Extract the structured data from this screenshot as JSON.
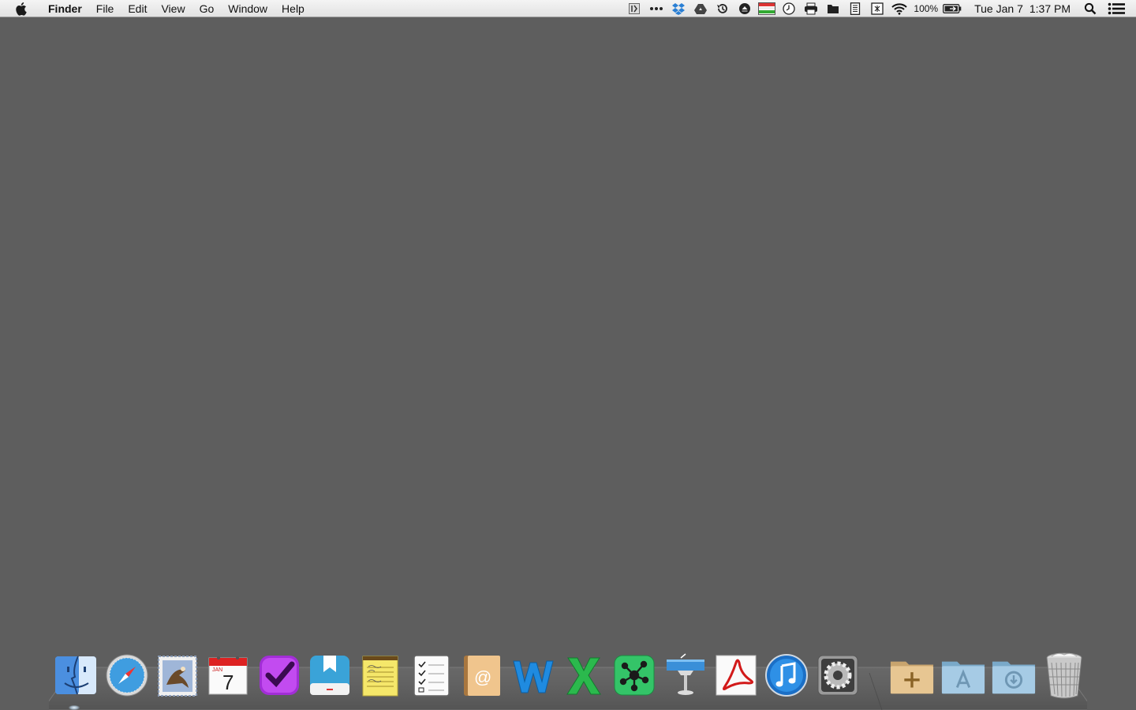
{
  "menubar": {
    "apple_icon": "apple-logo-icon",
    "items": [
      "Finder",
      "File",
      "Edit",
      "View",
      "Go",
      "Window",
      "Help"
    ],
    "status_icons": [
      "bracket-extension-icon",
      "more-dots-icon",
      "dropbox-icon",
      "google-drive-icon",
      "time-machine-icon",
      "eject-icon",
      "flag-strip-icon",
      "clock-icon",
      "printer-icon",
      "folder-icon",
      "document-icon",
      "screen-icon",
      "wifi-icon"
    ],
    "battery_percent": "100%",
    "battery_icon": "battery-charging-icon",
    "day": "Tue Jan 7",
    "time": "1:37 PM",
    "right_icons": [
      "spotlight-search-icon",
      "notification-center-icon"
    ]
  },
  "desktop": {
    "background": "#5e5e5e"
  },
  "dock": {
    "apps": [
      {
        "name": "finder-icon",
        "running": true
      },
      {
        "name": "safari-icon"
      },
      {
        "name": "mail-icon"
      },
      {
        "name": "calendar-icon",
        "month": "JAN",
        "day": "7"
      },
      {
        "name": "omnifocus-icon"
      },
      {
        "name": "day-one-icon"
      },
      {
        "name": "notes-icon"
      },
      {
        "name": "reminders-icon"
      },
      {
        "name": "contacts-icon"
      },
      {
        "name": "word-icon"
      },
      {
        "name": "excel-icon"
      },
      {
        "name": "mindnode-icon"
      },
      {
        "name": "keynote-icon"
      },
      {
        "name": "acrobat-icon"
      },
      {
        "name": "itunes-icon"
      },
      {
        "name": "system-preferences-icon"
      }
    ],
    "stacks": [
      "applications-folder-icon",
      "app-store-folder-icon",
      "downloads-folder-icon",
      "trash-icon"
    ]
  }
}
